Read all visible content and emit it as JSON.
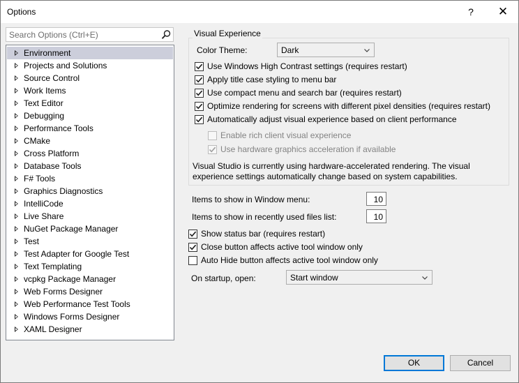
{
  "window": {
    "title": "Options",
    "help_glyph": "?",
    "close_glyph": "✕"
  },
  "search": {
    "placeholder": "Search Options (Ctrl+E)"
  },
  "tree": {
    "items": [
      "Environment",
      "Projects and Solutions",
      "Source Control",
      "Work Items",
      "Text Editor",
      "Debugging",
      "Performance Tools",
      "CMake",
      "Cross Platform",
      "Database Tools",
      "F# Tools",
      "Graphics Diagnostics",
      "IntelliCode",
      "Live Share",
      "NuGet Package Manager",
      "Test",
      "Test Adapter for Google Test",
      "Text Templating",
      "vcpkg Package Manager",
      "Web Forms Designer",
      "Web Performance Test Tools",
      "Windows Forms Designer",
      "XAML Designer"
    ],
    "selected": "Environment"
  },
  "visual_experience": {
    "group_title": "Visual Experience",
    "color_theme_label": "Color Theme:",
    "color_theme_value": "Dark",
    "checkboxes": [
      {
        "label": "Use Windows High Contrast settings (requires restart)",
        "checked": true,
        "enabled": true
      },
      {
        "label": "Apply title case styling to menu bar",
        "checked": true,
        "enabled": true
      },
      {
        "label": "Use compact menu and search bar (requires restart)",
        "checked": true,
        "enabled": true
      },
      {
        "label": "Optimize rendering for screens with different pixel densities (requires restart)",
        "checked": true,
        "enabled": true
      },
      {
        "label": "Automatically adjust visual experience based on client performance",
        "checked": true,
        "enabled": true
      },
      {
        "label": "Enable rich client visual experience",
        "checked": false,
        "enabled": false
      },
      {
        "label": "Use hardware graphics acceleration if available",
        "checked": true,
        "enabled": false
      }
    ],
    "description": "Visual Studio is currently using hardware-accelerated rendering. The visual experience settings automatically change based on system capabilities."
  },
  "window_menu": {
    "label": "Items to show in Window menu:",
    "value": "10"
  },
  "recent_files": {
    "label": "Items to show in recently used files list:",
    "value": "10"
  },
  "general_checkboxes": [
    {
      "label": "Show status bar (requires restart)",
      "checked": true
    },
    {
      "label": "Close button affects active tool window only",
      "checked": true
    },
    {
      "label": "Auto Hide button affects active tool window only",
      "checked": false
    }
  ],
  "startup": {
    "label": "On startup, open:",
    "value": "Start window"
  },
  "buttons": {
    "ok": "OK",
    "cancel": "Cancel"
  }
}
